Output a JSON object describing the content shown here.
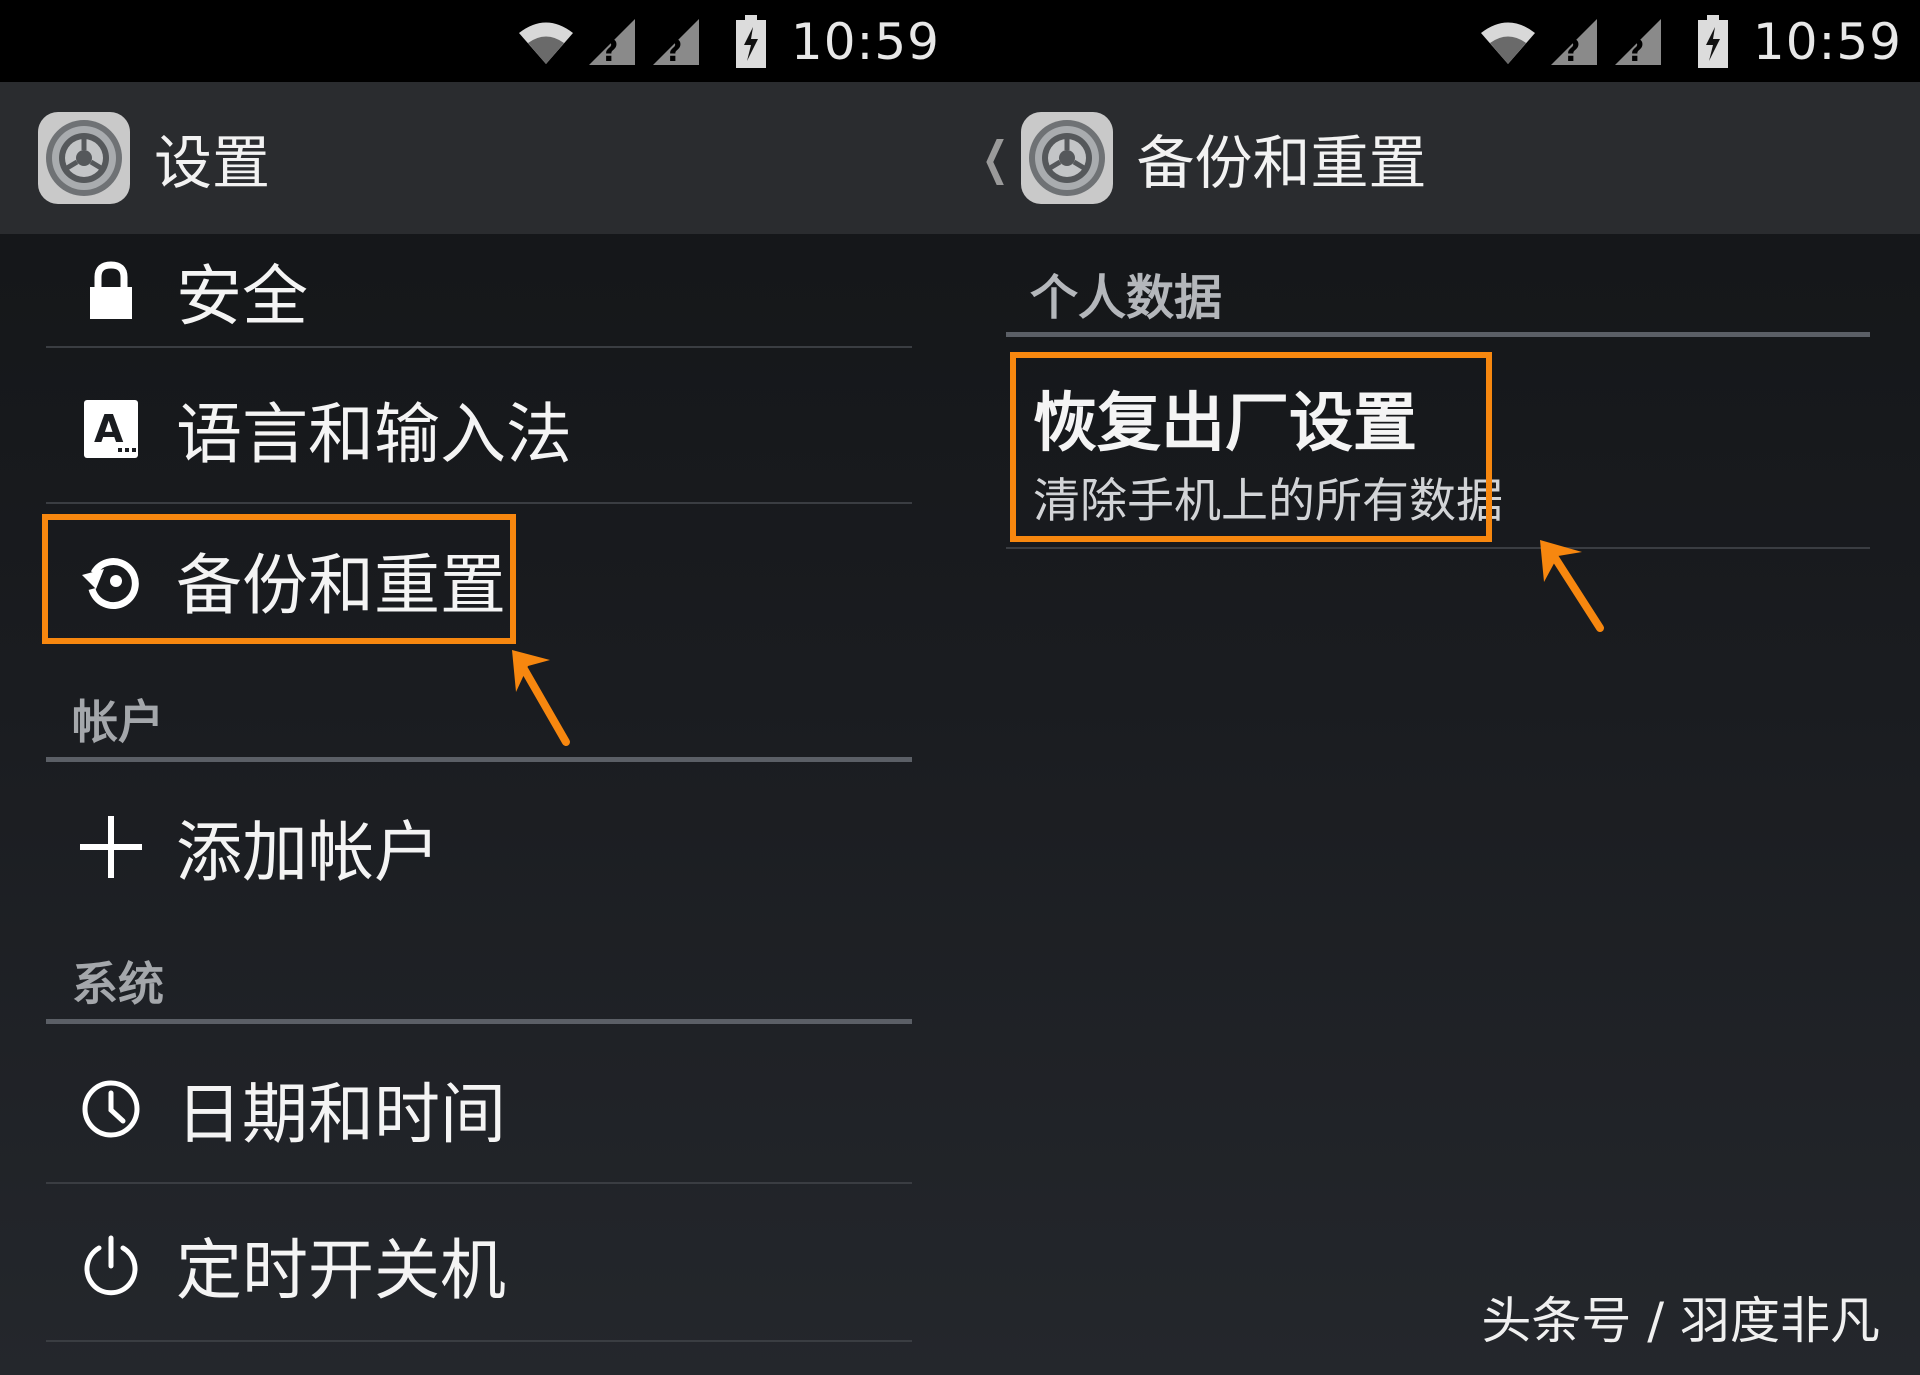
{
  "left": {
    "status": {
      "time": "10:59"
    },
    "header": {
      "title": "设置"
    },
    "items": [
      {
        "label": "安全"
      },
      {
        "label": "语言和输入法"
      },
      {
        "label": "备份和重置"
      },
      {
        "label": "添加帐户"
      },
      {
        "label": "日期和时间"
      },
      {
        "label": "定时开关机"
      }
    ],
    "sections": {
      "accounts": "帐户",
      "system": "系统"
    }
  },
  "right": {
    "status": {
      "time": "10:59"
    },
    "header": {
      "title": "备份和重置"
    },
    "section": "个人数据",
    "item": {
      "title": "恢复出厂设置",
      "subtitle": "清除手机上的所有数据"
    }
  },
  "watermark": "头条号 / 羽度非凡",
  "colors": {
    "highlight": "#f7870f",
    "divider": "#3a3d42",
    "section_rule": "#5b5f66",
    "actionbar": "#2a2c2f"
  }
}
